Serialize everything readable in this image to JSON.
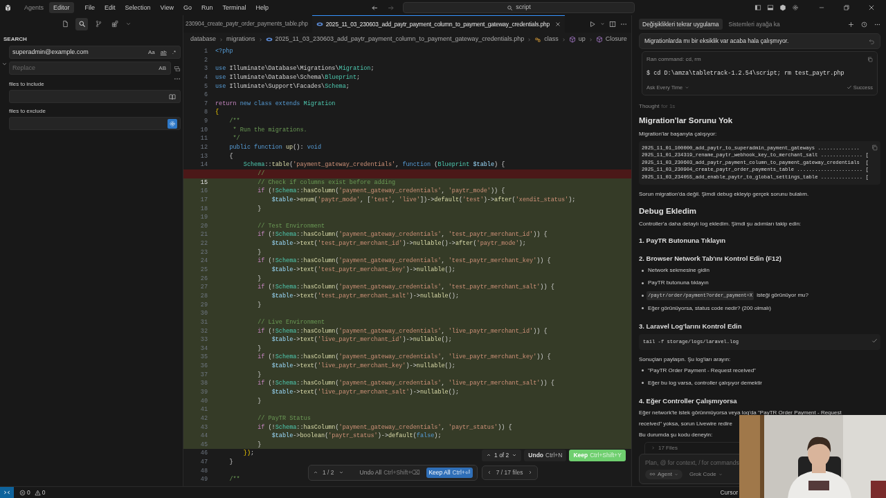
{
  "title_bar": {
    "modes": [
      {
        "label": "Agents",
        "selected": false
      },
      {
        "label": "Editor",
        "selected": true
      }
    ],
    "menu": [
      "File",
      "Edit",
      "Selection",
      "View",
      "Go",
      "Run",
      "Terminal",
      "Help"
    ],
    "command_center": {
      "value": "script"
    }
  },
  "sidebar": {
    "views": [
      {
        "kind": "files",
        "selected": false
      },
      {
        "kind": "search",
        "selected": true
      },
      {
        "kind": "source-control",
        "selected": false
      },
      {
        "kind": "extensions",
        "selected": false
      }
    ],
    "title": "SEARCH",
    "search": {
      "value": "superadmin@example.com",
      "options": [
        {
          "label": "Aa",
          "on": false
        },
        {
          "label": "ab",
          "on": false
        },
        {
          "label": ".*",
          "on": false
        }
      ]
    },
    "replace": {
      "placeholder": "Replace",
      "options": [
        {
          "label": "AB",
          "on": false
        }
      ]
    },
    "include": {
      "label": "files to include",
      "toggle_on": false
    },
    "exclude": {
      "label": "files to exclude",
      "toggle_on": true
    }
  },
  "editor": {
    "tabs": [
      {
        "label": "230904_create_paytr_order_payments_table.php",
        "selected": false
      },
      {
        "label": "2025_11_03_230603_add_paytr_payment_column_to_payment_gateway_credentials.php",
        "selected": true
      }
    ],
    "breadcrumb": [
      {
        "kind": "folder",
        "label": "database"
      },
      {
        "kind": "folder",
        "label": "migrations"
      },
      {
        "kind": "file",
        "label": "2025_11_03_230603_add_paytr_payment_column_to_payment_gateway_credentials.php"
      },
      {
        "kind": "class",
        "label": "class"
      },
      {
        "kind": "method",
        "label": "up"
      },
      {
        "kind": "method",
        "label": "Closure"
      }
    ],
    "lines": [
      {
        "n": "1",
        "kind": "normal",
        "tokens": [
          {
            "kind": "keyword",
            "text": "<?php"
          }
        ]
      },
      {
        "n": "2",
        "kind": "normal"
      },
      {
        "n": "3",
        "kind": "normal",
        "tokens": [
          {
            "kind": "keyword",
            "text": "use"
          },
          {
            "kind": "plain",
            "text": " Illuminate\\Database\\Migrations\\"
          },
          {
            "kind": "type",
            "text": "Migration"
          },
          {
            "kind": "plain",
            "text": ";"
          }
        ]
      },
      {
        "n": "4",
        "kind": "normal",
        "tokens": [
          {
            "kind": "keyword",
            "text": "use"
          },
          {
            "kind": "plain",
            "text": " Illuminate\\Database\\Schema\\"
          },
          {
            "kind": "type",
            "text": "Blueprint"
          },
          {
            "kind": "plain",
            "text": ";"
          }
        ]
      },
      {
        "n": "5",
        "kind": "normal",
        "tokens": [
          {
            "kind": "keyword",
            "text": "use"
          },
          {
            "kind": "plain",
            "text": " Illuminate\\Support\\Facades\\"
          },
          {
            "kind": "type",
            "text": "Schema"
          },
          {
            "kind": "plain",
            "text": ";"
          }
        ]
      },
      {
        "n": "6",
        "kind": "normal"
      },
      {
        "n": "7",
        "kind": "normal",
        "tokens": [
          {
            "kind": "control",
            "text": "return"
          },
          {
            "kind": "keyword",
            "text": " new class extends"
          },
          {
            "kind": "type",
            "text": " Migration"
          }
        ]
      },
      {
        "n": "8",
        "kind": "normal",
        "tokens": [
          {
            "kind": "bracket",
            "text": "{"
          }
        ]
      },
      {
        "n": "9",
        "kind": "normal",
        "tokens": [
          {
            "kind": "comment",
            "text": "    /**"
          }
        ]
      },
      {
        "n": "10",
        "kind": "normal",
        "tokens": [
          {
            "kind": "comment",
            "text": "     * Run the migrations."
          }
        ]
      },
      {
        "n": "11",
        "kind": "normal",
        "tokens": [
          {
            "kind": "comment",
            "text": "     */"
          }
        ]
      },
      {
        "n": "12",
        "kind": "normal",
        "tokens": [
          {
            "kind": "keyword",
            "text": "    public function"
          },
          {
            "kind": "function",
            "text": " up"
          },
          {
            "kind": "plain",
            "text": "(): "
          },
          {
            "kind": "keyword",
            "text": "void"
          }
        ]
      },
      {
        "n": "13",
        "kind": "normal",
        "tokens": [
          {
            "kind": "plain",
            "text": "    {"
          }
        ]
      },
      {
        "n": "14",
        "kind": "normal",
        "tokens": [
          {
            "kind": "type",
            "text": "        Schema"
          },
          {
            "kind": "plain",
            "text": "::"
          },
          {
            "kind": "function",
            "text": "table"
          },
          {
            "kind": "plain",
            "text": "("
          },
          {
            "kind": "string",
            "text": "'payment_gateway_credentials'"
          },
          {
            "kind": "plain",
            "text": ", "
          },
          {
            "kind": "keyword",
            "text": "function"
          },
          {
            "kind": "plain",
            "text": " ("
          },
          {
            "kind": "type",
            "text": "Blueprint"
          },
          {
            "kind": "variable",
            "text": " $table"
          },
          {
            "kind": "plain",
            "text": ") {"
          }
        ]
      },
      {
        "kind": "deleted",
        "tokens": [
          {
            "kind": "comment",
            "text": "            //"
          }
        ]
      },
      {
        "n": "15",
        "kind": "added",
        "current": true,
        "tokens": [
          {
            "kind": "comment",
            "text": "            // Check if columns exist before adding"
          }
        ]
      },
      {
        "n": "16",
        "kind": "added",
        "tokens": [
          {
            "kind": "control",
            "text": "            if"
          },
          {
            "kind": "plain",
            "text": " (!"
          },
          {
            "kind": "type",
            "text": "Schema"
          },
          {
            "kind": "plain",
            "text": "::"
          },
          {
            "kind": "function",
            "text": "hasColumn"
          },
          {
            "kind": "plain",
            "text": "("
          },
          {
            "kind": "string",
            "text": "'payment_gateway_credentials'"
          },
          {
            "kind": "plain",
            "text": ", "
          },
          {
            "kind": "string",
            "text": "'paytr_mode'"
          },
          {
            "kind": "plain",
            "text": ")) {"
          }
        ]
      },
      {
        "n": "17",
        "kind": "added",
        "tokens": [
          {
            "kind": "variable",
            "text": "                $table"
          },
          {
            "kind": "plain",
            "text": "->"
          },
          {
            "kind": "function",
            "text": "enum"
          },
          {
            "kind": "plain",
            "text": "("
          },
          {
            "kind": "string",
            "text": "'paytr_mode'"
          },
          {
            "kind": "plain",
            "text": ", ["
          },
          {
            "kind": "string",
            "text": "'test'"
          },
          {
            "kind": "plain",
            "text": ", "
          },
          {
            "kind": "string",
            "text": "'live'"
          },
          {
            "kind": "plain",
            "text": "])->"
          },
          {
            "kind": "function",
            "text": "default"
          },
          {
            "kind": "plain",
            "text": "("
          },
          {
            "kind": "string",
            "text": "'test'"
          },
          {
            "kind": "plain",
            "text": ")->"
          },
          {
            "kind": "function",
            "text": "after"
          },
          {
            "kind": "plain",
            "text": "("
          },
          {
            "kind": "string",
            "text": "'xendit_status'"
          },
          {
            "kind": "plain",
            "text": ");"
          }
        ]
      },
      {
        "n": "18",
        "kind": "added",
        "tokens": [
          {
            "kind": "plain",
            "text": "            }"
          }
        ]
      },
      {
        "n": "19",
        "kind": "added"
      },
      {
        "n": "20",
        "kind": "added",
        "tokens": [
          {
            "kind": "comment",
            "text": "            // Test Environment"
          }
        ]
      },
      {
        "n": "21",
        "kind": "added",
        "tokens": [
          {
            "kind": "control",
            "text": "            if"
          },
          {
            "kind": "plain",
            "text": " (!"
          },
          {
            "kind": "type",
            "text": "Schema"
          },
          {
            "kind": "plain",
            "text": "::"
          },
          {
            "kind": "function",
            "text": "hasColumn"
          },
          {
            "kind": "plain",
            "text": "("
          },
          {
            "kind": "string",
            "text": "'payment_gateway_credentials'"
          },
          {
            "kind": "plain",
            "text": ", "
          },
          {
            "kind": "string",
            "text": "'test_paytr_merchant_id'"
          },
          {
            "kind": "plain",
            "text": ")) {"
          }
        ]
      },
      {
        "n": "22",
        "kind": "added",
        "tokens": [
          {
            "kind": "variable",
            "text": "                $table"
          },
          {
            "kind": "plain",
            "text": "->"
          },
          {
            "kind": "function",
            "text": "text"
          },
          {
            "kind": "plain",
            "text": "("
          },
          {
            "kind": "string",
            "text": "'test_paytr_merchant_id'"
          },
          {
            "kind": "plain",
            "text": ")->"
          },
          {
            "kind": "function",
            "text": "nullable"
          },
          {
            "kind": "plain",
            "text": "()->"
          },
          {
            "kind": "function",
            "text": "after"
          },
          {
            "kind": "plain",
            "text": "("
          },
          {
            "kind": "string",
            "text": "'paytr_mode'"
          },
          {
            "kind": "plain",
            "text": ");"
          }
        ]
      },
      {
        "n": "23",
        "kind": "added",
        "tokens": [
          {
            "kind": "plain",
            "text": "            }"
          }
        ]
      },
      {
        "n": "24",
        "kind": "added",
        "tokens": [
          {
            "kind": "control",
            "text": "            if"
          },
          {
            "kind": "plain",
            "text": " (!"
          },
          {
            "kind": "type",
            "text": "Schema"
          },
          {
            "kind": "plain",
            "text": "::"
          },
          {
            "kind": "function",
            "text": "hasColumn"
          },
          {
            "kind": "plain",
            "text": "("
          },
          {
            "kind": "string",
            "text": "'payment_gateway_credentials'"
          },
          {
            "kind": "plain",
            "text": ", "
          },
          {
            "kind": "string",
            "text": "'test_paytr_merchant_key'"
          },
          {
            "kind": "plain",
            "text": ")) {"
          }
        ]
      },
      {
        "n": "25",
        "kind": "added",
        "tokens": [
          {
            "kind": "variable",
            "text": "                $table"
          },
          {
            "kind": "plain",
            "text": "->"
          },
          {
            "kind": "function",
            "text": "text"
          },
          {
            "kind": "plain",
            "text": "("
          },
          {
            "kind": "string",
            "text": "'test_paytr_merchant_key'"
          },
          {
            "kind": "plain",
            "text": ")->"
          },
          {
            "kind": "function",
            "text": "nullable"
          },
          {
            "kind": "plain",
            "text": "();"
          }
        ]
      },
      {
        "n": "26",
        "kind": "added",
        "tokens": [
          {
            "kind": "plain",
            "text": "            }"
          }
        ]
      },
      {
        "n": "27",
        "kind": "added",
        "tokens": [
          {
            "kind": "control",
            "text": "            if"
          },
          {
            "kind": "plain",
            "text": " (!"
          },
          {
            "kind": "type",
            "text": "Schema"
          },
          {
            "kind": "plain",
            "text": "::"
          },
          {
            "kind": "function",
            "text": "hasColumn"
          },
          {
            "kind": "plain",
            "text": "("
          },
          {
            "kind": "string",
            "text": "'payment_gateway_credentials'"
          },
          {
            "kind": "plain",
            "text": ", "
          },
          {
            "kind": "string",
            "text": "'test_paytr_merchant_salt'"
          },
          {
            "kind": "plain",
            "text": ")) {"
          }
        ]
      },
      {
        "n": "28",
        "kind": "added",
        "tokens": [
          {
            "kind": "variable",
            "text": "                $table"
          },
          {
            "kind": "plain",
            "text": "->"
          },
          {
            "kind": "function",
            "text": "text"
          },
          {
            "kind": "plain",
            "text": "("
          },
          {
            "kind": "string",
            "text": "'test_paytr_merchant_salt'"
          },
          {
            "kind": "plain",
            "text": ")->"
          },
          {
            "kind": "function",
            "text": "nullable"
          },
          {
            "kind": "plain",
            "text": "();"
          }
        ]
      },
      {
        "n": "29",
        "kind": "added",
        "tokens": [
          {
            "kind": "plain",
            "text": "            }"
          }
        ]
      },
      {
        "n": "30",
        "kind": "added"
      },
      {
        "n": "31",
        "kind": "added",
        "tokens": [
          {
            "kind": "comment",
            "text": "            // Live Environment"
          }
        ]
      },
      {
        "n": "32",
        "kind": "added",
        "tokens": [
          {
            "kind": "control",
            "text": "            if"
          },
          {
            "kind": "plain",
            "text": " (!"
          },
          {
            "kind": "type",
            "text": "Schema"
          },
          {
            "kind": "plain",
            "text": "::"
          },
          {
            "kind": "function",
            "text": "hasColumn"
          },
          {
            "kind": "plain",
            "text": "("
          },
          {
            "kind": "string",
            "text": "'payment_gateway_credentials'"
          },
          {
            "kind": "plain",
            "text": ", "
          },
          {
            "kind": "string",
            "text": "'live_paytr_merchant_id'"
          },
          {
            "kind": "plain",
            "text": ")) {"
          }
        ]
      },
      {
        "n": "33",
        "kind": "added",
        "tokens": [
          {
            "kind": "variable",
            "text": "                $table"
          },
          {
            "kind": "plain",
            "text": "->"
          },
          {
            "kind": "function",
            "text": "text"
          },
          {
            "kind": "plain",
            "text": "("
          },
          {
            "kind": "string",
            "text": "'live_paytr_merchant_id'"
          },
          {
            "kind": "plain",
            "text": ")->"
          },
          {
            "kind": "function",
            "text": "nullable"
          },
          {
            "kind": "plain",
            "text": "();"
          }
        ]
      },
      {
        "n": "34",
        "kind": "added",
        "tokens": [
          {
            "kind": "plain",
            "text": "            }"
          }
        ]
      },
      {
        "n": "35",
        "kind": "added",
        "tokens": [
          {
            "kind": "control",
            "text": "            if"
          },
          {
            "kind": "plain",
            "text": " (!"
          },
          {
            "kind": "type",
            "text": "Schema"
          },
          {
            "kind": "plain",
            "text": "::"
          },
          {
            "kind": "function",
            "text": "hasColumn"
          },
          {
            "kind": "plain",
            "text": "("
          },
          {
            "kind": "string",
            "text": "'payment_gateway_credentials'"
          },
          {
            "kind": "plain",
            "text": ", "
          },
          {
            "kind": "string",
            "text": "'live_paytr_merchant_key'"
          },
          {
            "kind": "plain",
            "text": ")) {"
          }
        ]
      },
      {
        "n": "36",
        "kind": "added",
        "tokens": [
          {
            "kind": "variable",
            "text": "                $table"
          },
          {
            "kind": "plain",
            "text": "->"
          },
          {
            "kind": "function",
            "text": "text"
          },
          {
            "kind": "plain",
            "text": "("
          },
          {
            "kind": "string",
            "text": "'live_paytr_merchant_key'"
          },
          {
            "kind": "plain",
            "text": ")->"
          },
          {
            "kind": "function",
            "text": "nullable"
          },
          {
            "kind": "plain",
            "text": "();"
          }
        ]
      },
      {
        "n": "37",
        "kind": "added",
        "tokens": [
          {
            "kind": "plain",
            "text": "            }"
          }
        ]
      },
      {
        "n": "38",
        "kind": "added",
        "tokens": [
          {
            "kind": "control",
            "text": "            if"
          },
          {
            "kind": "plain",
            "text": " (!"
          },
          {
            "kind": "type",
            "text": "Schema"
          },
          {
            "kind": "plain",
            "text": "::"
          },
          {
            "kind": "function",
            "text": "hasColumn"
          },
          {
            "kind": "plain",
            "text": "("
          },
          {
            "kind": "string",
            "text": "'payment_gateway_credentials'"
          },
          {
            "kind": "plain",
            "text": ", "
          },
          {
            "kind": "string",
            "text": "'live_paytr_merchant_salt'"
          },
          {
            "kind": "plain",
            "text": ")) {"
          }
        ]
      },
      {
        "n": "39",
        "kind": "added",
        "tokens": [
          {
            "kind": "variable",
            "text": "                $table"
          },
          {
            "kind": "plain",
            "text": "->"
          },
          {
            "kind": "function",
            "text": "text"
          },
          {
            "kind": "plain",
            "text": "("
          },
          {
            "kind": "string",
            "text": "'live_paytr_merchant_salt'"
          },
          {
            "kind": "plain",
            "text": ")->"
          },
          {
            "kind": "function",
            "text": "nullable"
          },
          {
            "kind": "plain",
            "text": "();"
          }
        ]
      },
      {
        "n": "40",
        "kind": "added",
        "tokens": [
          {
            "kind": "plain",
            "text": "            }"
          }
        ]
      },
      {
        "n": "41",
        "kind": "added"
      },
      {
        "n": "42",
        "kind": "added",
        "tokens": [
          {
            "kind": "comment",
            "text": "            // PayTR Status"
          }
        ]
      },
      {
        "n": "43",
        "kind": "added",
        "tokens": [
          {
            "kind": "control",
            "text": "            if"
          },
          {
            "kind": "plain",
            "text": " (!"
          },
          {
            "kind": "type",
            "text": "Schema"
          },
          {
            "kind": "plain",
            "text": "::"
          },
          {
            "kind": "function",
            "text": "hasColumn"
          },
          {
            "kind": "plain",
            "text": "("
          },
          {
            "kind": "string",
            "text": "'payment_gateway_credentials'"
          },
          {
            "kind": "plain",
            "text": ", "
          },
          {
            "kind": "string",
            "text": "'paytr_status'"
          },
          {
            "kind": "plain",
            "text": ")) {"
          }
        ]
      },
      {
        "n": "44",
        "kind": "added",
        "tokens": [
          {
            "kind": "variable",
            "text": "                $table"
          },
          {
            "kind": "plain",
            "text": "->"
          },
          {
            "kind": "function",
            "text": "boolean"
          },
          {
            "kind": "plain",
            "text": "("
          },
          {
            "kind": "string",
            "text": "'paytr_status'"
          },
          {
            "kind": "plain",
            "text": ")->"
          },
          {
            "kind": "function",
            "text": "default"
          },
          {
            "kind": "plain",
            "text": "("
          },
          {
            "kind": "keyword",
            "text": "false"
          },
          {
            "kind": "plain",
            "text": ");"
          }
        ]
      },
      {
        "n": "45",
        "kind": "added",
        "tokens": [
          {
            "kind": "plain",
            "text": "            }"
          }
        ]
      },
      {
        "n": "46",
        "kind": "normal",
        "tokens": [
          {
            "kind": "bracket",
            "text": "        })"
          },
          {
            "kind": "plain",
            "text": ";"
          }
        ]
      },
      {
        "n": "47",
        "kind": "normal",
        "tokens": [
          {
            "kind": "plain",
            "text": "    }"
          }
        ]
      },
      {
        "n": "48",
        "kind": "normal"
      },
      {
        "n": "49",
        "kind": "normal",
        "tokens": [
          {
            "kind": "comment",
            "text": "    /**"
          }
        ]
      }
    ],
    "diff_widget": {
      "position": "1 of 2",
      "undo": {
        "label": "Undo",
        "shortcut": "Ctrl+N"
      },
      "keep": {
        "label": "Keep",
        "shortcut": "Ctrl+Shift+Y"
      }
    },
    "review_bar": {
      "position": "1 / 2",
      "undo_all": {
        "label": "Undo All",
        "shortcut": "Ctrl+Shift+⌫"
      },
      "keep_all": {
        "label": "Keep All",
        "shortcut": "Ctrl+⏎"
      },
      "files": "7 / 17 files"
    }
  },
  "chat": {
    "tabs": [
      {
        "label": "Değişiklikleri tekrar uygulama",
        "selected": true
      },
      {
        "label": "Sistemleri ayağa ka",
        "selected": false
      }
    ],
    "user_message": "Migrationlarda mı bir eksiklik var acaba hala çalışmıyor.",
    "command": {
      "title": "Ran command: cd, rm",
      "text": "$ cd D:\\amza\\tabletrack-1.2.54\\script; rm test_paytr.php",
      "approval": "Ask Every Time",
      "status": "Success"
    },
    "thought": {
      "label": "Thought",
      "duration": "for 1s"
    },
    "blocks": [
      {
        "kind": "h2",
        "text": "Migration'lar Sorunu Yok"
      },
      {
        "kind": "p",
        "text": "Migration'lar başarıyla çalışıyor:"
      },
      {
        "kind": "code",
        "copied": false,
        "lines": [
          "2025_11_01_100000_add_paytr_to_superadmin_payment_gateways ..............",
          "2025_11_01_234319_rename_paytr_webhook_key_to_merchant_salt .............. [",
          "2025_11_03_230603_add_paytr_payment_column_to_payment_gateway_credentials  [",
          "2025_11_03_230904_create_paytr_order_payments_table ...................... [",
          "2025_11_03_234055_add_enable_paytr_to_global_settings_table .............. ["
        ]
      },
      {
        "kind": "p",
        "text": "Sorun migration'da değil. Şimdi debug ekleyip gerçek sorunu bulalım."
      },
      {
        "kind": "h2",
        "text": "Debug Ekledim"
      },
      {
        "kind": "p",
        "text": "Controller'a daha detaylı log ekledim. Şimdi şu adımları takip edin:"
      },
      {
        "kind": "h3",
        "text": "1. PayTR Butonuna Tıklayın"
      },
      {
        "kind": "h3",
        "text": "2. Browser Network Tab'ını Kontrol Edin (F12)"
      },
      {
        "kind": "ul",
        "items": [
          {
            "text": "Network sekmesine gidin"
          },
          {
            "text": "PayTR butonuna tıklayın"
          },
          {
            "code": "/paytr/order/payment?order_payment=X",
            "text": "isteği görünüyor mu?"
          },
          {
            "text": "Eğer görünüyorsa, status code nedir? (200 olmalı)"
          }
        ]
      },
      {
        "kind": "h3",
        "text": "3. Laravel Log'larını Kontrol Edin"
      },
      {
        "kind": "code",
        "copied": true,
        "lines": [
          "tail -f storage/logs/laravel.log"
        ]
      },
      {
        "kind": "p",
        "text": "Sonuçları paylaşın. Şu log'ları arayın:"
      },
      {
        "kind": "ul",
        "items": [
          {
            "text": "\"PayTR Order Payment - Request received\""
          },
          {
            "text": "Eğer bu log varsa, controller çalışıyor demektir"
          }
        ]
      },
      {
        "kind": "h3",
        "text": "4. Eğer Controller Çalışmıyorsa"
      },
      {
        "kind": "p",
        "text": "Eğer network'te istek görünmüyorsa veya log'da \"PayTR Order Payment - Request"
      },
      {
        "kind": "p",
        "text": "received\" yoksa, sorun Livewire redire"
      },
      {
        "kind": "p",
        "text": "Bu durumda şu kodu deneyin:"
      }
    ],
    "files_row": "17 Files",
    "input": {
      "placeholder": "Plan, @ for context, / for commands",
      "mode": "Agent",
      "model": "Grok Code"
    }
  },
  "status_bar": {
    "errors": "0",
    "warnings": "0",
    "product": "Cursor"
  }
}
